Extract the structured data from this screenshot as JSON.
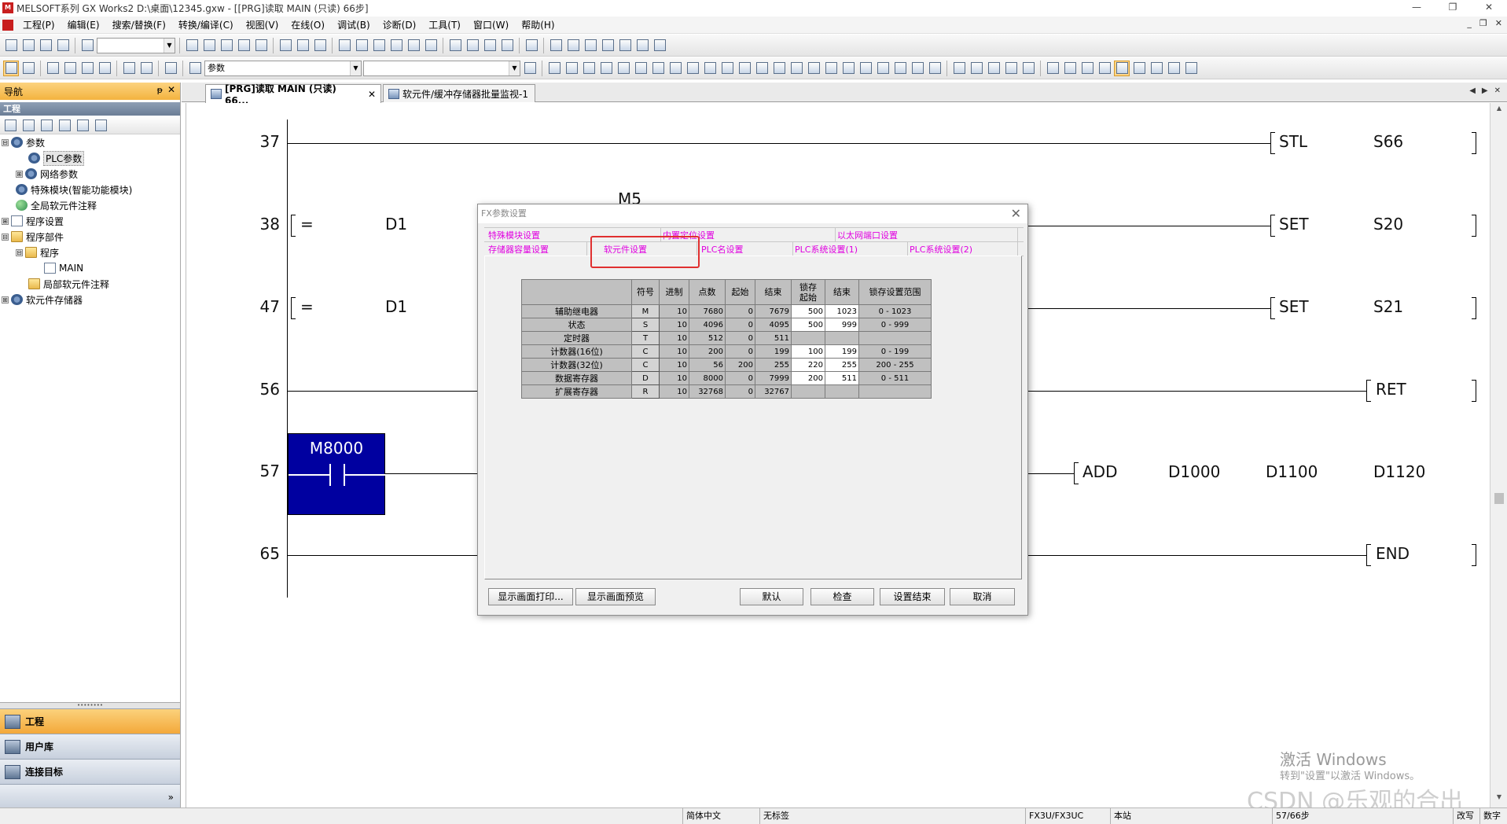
{
  "window": {
    "title": "MELSOFT系列 GX Works2 D:\\桌面\\12345.gxw - [[PRG]读取 MAIN (只读) 66步]",
    "app_icon": "melsoft-icon",
    "controls": [
      "—",
      "❐",
      "✕"
    ]
  },
  "menu": {
    "items": [
      "工程(P)",
      "编辑(E)",
      "搜索/替换(F)",
      "转换/编译(C)",
      "视图(V)",
      "在线(O)",
      "调试(B)",
      "诊断(D)",
      "工具(T)",
      "窗口(W)",
      "帮助(H)"
    ],
    "mdi_controls": [
      "_",
      "❐",
      "✕"
    ]
  },
  "toolbar": {
    "combo1": "",
    "combo2": "参数",
    "combo3": ""
  },
  "nav": {
    "title": "导航",
    "pin": "ᵽ",
    "close": "✕",
    "section": "工程",
    "tree": [
      {
        "label": "参数",
        "exp": "⊟"
      },
      {
        "label": "PLC参数",
        "exp": ""
      },
      {
        "label": "网络参数",
        "exp": "⊞"
      },
      {
        "label": "特殊模块(智能功能模块)",
        "exp": ""
      },
      {
        "label": "全局软元件注释",
        "exp": ""
      },
      {
        "label": "程序设置",
        "exp": "⊞"
      },
      {
        "label": "程序部件",
        "exp": "⊟"
      },
      {
        "label": "程序",
        "exp": "⊟"
      },
      {
        "label": "MAIN",
        "exp": ""
      },
      {
        "label": "局部软元件注释",
        "exp": ""
      },
      {
        "label": "软元件存储器",
        "exp": "⊞"
      }
    ],
    "buttons": [
      {
        "label": "工程",
        "icon": "project-icon"
      },
      {
        "label": "用户库",
        "icon": "library-icon"
      },
      {
        "label": "连接目标",
        "icon": "connection-icon"
      }
    ],
    "more": "»"
  },
  "tabs": [
    {
      "label": "[PRG]读取 MAIN (只读) 66...",
      "close": "✕"
    },
    {
      "label": "软元件/缓冲存储器批量监视-1"
    }
  ],
  "tab_nav": {
    "prev": "◀",
    "next": "▶",
    "close": "✕"
  },
  "ladder": {
    "rungs": [
      {
        "line": "37",
        "instr": "STL",
        "arg1": "S66"
      },
      {
        "line": "38",
        "cmp": "=",
        "cmp_arg": "D1",
        "above": "M5",
        "instr": "SET",
        "arg1": "S20"
      },
      {
        "line": "47",
        "cmp": "=",
        "cmp_arg": "D1",
        "instr": "SET",
        "arg1": "S21"
      },
      {
        "line": "56",
        "instr": "RET"
      },
      {
        "line": "57",
        "contact": "M8000",
        "instr": "ADD",
        "args": [
          "D1000",
          "D1100",
          "D1120"
        ]
      },
      {
        "line": "65",
        "instr": "END"
      }
    ]
  },
  "dialog": {
    "title": "FX参数设置",
    "close": "✕",
    "tabs_row1": [
      "特殊模块设置",
      "内置定位设置",
      "以太网端口设置"
    ],
    "tabs_row2": [
      "存储器容量设置",
      "软元件设置",
      "PLC名设置",
      "PLC系统设置(1)",
      "PLC系统设置(2)"
    ],
    "table": {
      "headers": [
        "符号",
        "进制",
        "点数",
        "起始",
        "结束",
        "锁存\n起始",
        "结束",
        "锁存设置范围"
      ],
      "rows": [
        {
          "name": "辅助继电器",
          "sym": "M",
          "base": "10",
          "points": "7680",
          "start": "0",
          "end": "7679",
          "lstart": "500",
          "lend": "1023",
          "range": "0 - 1023"
        },
        {
          "name": "状态",
          "sym": "S",
          "base": "10",
          "points": "4096",
          "start": "0",
          "end": "4095",
          "lstart": "500",
          "lend": "999",
          "range": "0 - 999"
        },
        {
          "name": "定时器",
          "sym": "T",
          "base": "10",
          "points": "512",
          "start": "0",
          "end": "511",
          "lstart": "",
          "lend": "",
          "range": ""
        },
        {
          "name": "计数器(16位)",
          "sym": "C",
          "base": "10",
          "points": "200",
          "start": "0",
          "end": "199",
          "lstart": "100",
          "lend": "199",
          "range": "0 - 199"
        },
        {
          "name": "计数器(32位)",
          "sym": "C",
          "base": "10",
          "points": "56",
          "start": "200",
          "end": "255",
          "lstart": "220",
          "lend": "255",
          "range": "200 - 255"
        },
        {
          "name": "数据寄存器",
          "sym": "D",
          "base": "10",
          "points": "8000",
          "start": "0",
          "end": "7999",
          "lstart": "200",
          "lend": "511",
          "range": "0 - 511"
        },
        {
          "name": "扩展寄存器",
          "sym": "R",
          "base": "10",
          "points": "32768",
          "start": "0",
          "end": "32767",
          "lstart": "",
          "lend": "",
          "range": ""
        }
      ]
    },
    "buttons": {
      "print": "显示画面打印...",
      "preview": "显示画面预览",
      "default": "默认",
      "check": "检查",
      "finish": "设置结束",
      "cancel": "取消"
    }
  },
  "watermark": {
    "line1": "激活 Windows",
    "line2": "转到\"设置\"以激活 Windows。",
    "csdn": "CSDN @乐观的合出"
  },
  "status": {
    "ime": "简体中文",
    "label": "无标签",
    "model": "FX3U/FX3UC",
    "station": "本站",
    "steps": "57/66步",
    "mode": "改写",
    "num": "数字"
  },
  "colors": {
    "accent_orange": "#f3b33f",
    "contact_fill": "#0000a0",
    "tab_magenta": "#e000e0",
    "highlight_red": "#e03030"
  }
}
